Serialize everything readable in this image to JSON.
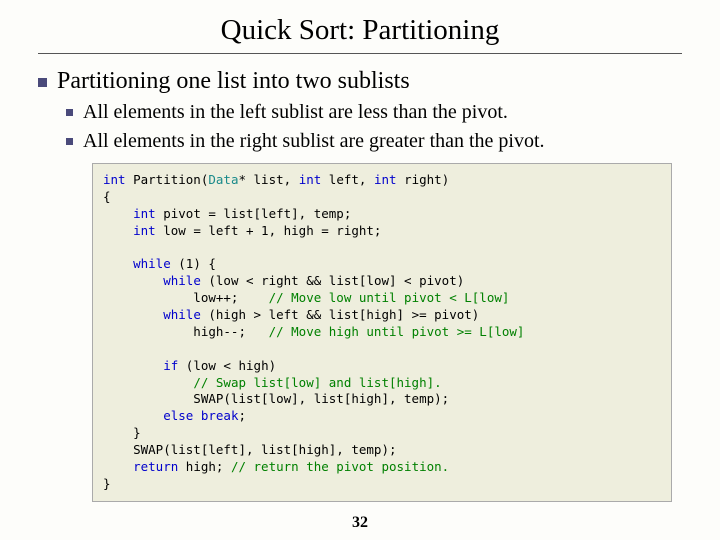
{
  "title": "Quick Sort: Partitioning",
  "bullets": {
    "l1": "Partitioning one list into two sublists",
    "l2a": "All elements in the left sublist are less than the pivot.",
    "l2b": "All elements in the right sublist are greater than the pivot."
  },
  "code": {
    "t_int1": "int",
    "t_fn": " Partition(",
    "t_data": "Data",
    "t_sig": "* list, ",
    "t_int2": "int",
    "t_left": " left, ",
    "t_int3": "int",
    "t_right": " right)",
    "l2": "{",
    "l3a": "    ",
    "l3_int": "int",
    "l3b": " pivot = list[left], temp;",
    "l4a": "    ",
    "l4_int": "int",
    "l4b": " low = left + 1, high = right;",
    "blank": "",
    "l6a": "    ",
    "l6_while": "while",
    "l6b": " (1) {",
    "l7a": "        ",
    "l7_while": "while",
    "l7b": " (low < right && list[low] < pivot)",
    "l8a": "            low++;    ",
    "l8_cm": "// Move low until pivot < L[low]",
    "l9a": "        ",
    "l9_while": "while",
    "l9b": " (high > left && list[high] >= pivot)",
    "l10a": "            high--;   ",
    "l10_cm": "// Move high until pivot >= L[low]",
    "l12a": "        ",
    "l12_if": "if",
    "l12b": " (low < high)",
    "l13a": "            ",
    "l13_cm": "// Swap list[low] and list[high].",
    "l14": "            SWAP(list[low], list[high], temp);",
    "l15a": "        ",
    "l15_else": "else",
    "l15b": " ",
    "l15_break": "break",
    "l15c": ";",
    "l16": "    }",
    "l17": "    SWAP(list[left], list[high], temp);",
    "l18a": "    ",
    "l18_return": "return",
    "l18b": " high; ",
    "l18_cm": "// return the pivot position.",
    "l19": "}"
  },
  "page": "32"
}
